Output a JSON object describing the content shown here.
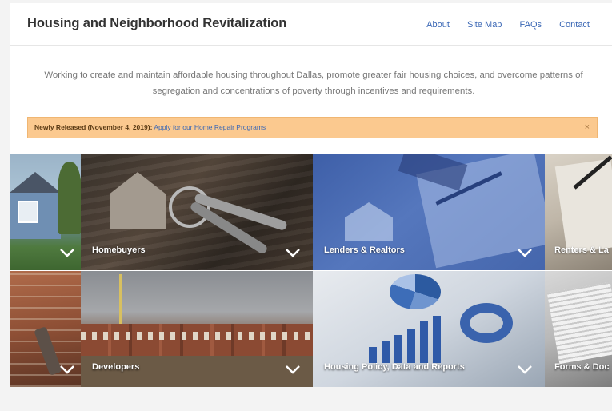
{
  "header": {
    "site_title": "Housing and Neighborhood Revitalization",
    "nav": [
      "About",
      "Site Map",
      "FAQs",
      "Contact"
    ]
  },
  "mission": "Working to create and maintain affordable housing throughout Dallas, promote greater fair housing choices, and overcome patterns of segregation and concentrations of poverty through incentives and requirements.",
  "alert": {
    "prefix": "Newly Released (November 4, 2019):",
    "link": "Apply for our Home Repair Programs",
    "close": "×"
  },
  "tiles": {
    "homebuyers": "Homebuyers",
    "lenders": "Lenders & Realtors",
    "renters": "Renters & La",
    "developers": "Developers",
    "policy": "Housing Policy, Data and Reports",
    "forms": "Forms & Doc"
  },
  "icons": {
    "chevron": "chevron-down-icon",
    "close": "close-icon"
  },
  "colors": {
    "link": "#3a67b5",
    "alert_bg": "#fbc98f",
    "title": "#333333",
    "text_muted": "#777777"
  }
}
